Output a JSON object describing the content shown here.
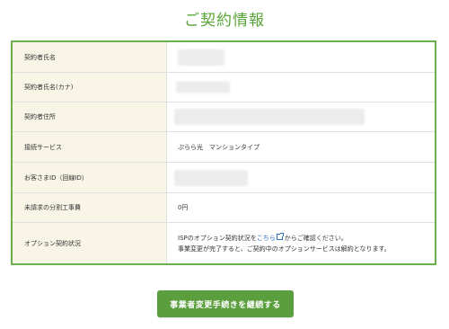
{
  "page": {
    "title": "ご契約情報",
    "accent_color": "#5aa53a"
  },
  "contract": {
    "rows": [
      {
        "label": "契約者氏名",
        "value": ""
      },
      {
        "label": "契約者氏名(カナ)",
        "value": ""
      },
      {
        "label": "契約者住所",
        "value": ""
      },
      {
        "label": "接続サービス",
        "value": "ぷらら光　マンションタイプ"
      },
      {
        "label": "お客さまID（回線ID）",
        "value": ""
      },
      {
        "label": "未請求の分割工事費",
        "value": "0円"
      },
      {
        "label": "オプション契約状況",
        "value": ""
      }
    ],
    "option_text": {
      "line1_before": "ISPのオプション契約状況を",
      "line1_link": "こちら",
      "line1_after": "からご確認ください。",
      "line2": "事業変更が完了すると、ご契約中のオプションサービスは解約となります。"
    }
  },
  "actions": {
    "continue_button": "事業者変更手続きを継続する",
    "button_color": "#5a9e3e"
  }
}
